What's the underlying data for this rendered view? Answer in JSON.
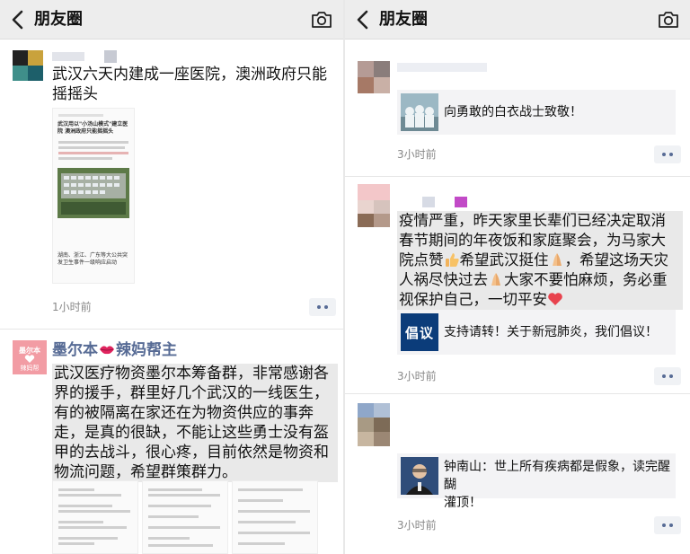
{
  "left": {
    "nav": {
      "title": "朋友圈",
      "back_icon": "chevron-left-icon",
      "camera_icon": "camera-icon"
    },
    "post1": {
      "text_lines": [
        "武汉六天内建成一座医院，澳洲政府只能",
        "摇摇头"
      ],
      "screenshot_title": "武汉用以\"小汤山模式\"建立医院 澳洲政府只能摇摇头",
      "screenshot_caption": "湖南、浙江、广东等大公共突发卫生事件一级响应启动",
      "time": "1小时前"
    },
    "post2": {
      "nickname": "墨尔本💋辣妈帮主",
      "nickname_main": "墨尔本",
      "nickname_tail": "辣妈帮主",
      "avatar_label_top": "墨尔本",
      "avatar_label_bottom": "辣妈帮",
      "text_lines": [
        "武汉医疗物资墨尔本筹备群，非常感谢各",
        "界的援手，群里好几个武汉的一线医生，",
        "有的被隔离在家还在为物资供应的事奔",
        "走，是真的很缺，不能让这些勇士没有盔",
        "甲的去战斗，很心疼，目前依然是物资和",
        "物流问题，希望群策群力。"
      ]
    }
  },
  "right": {
    "nav": {
      "title": "朋友圈",
      "back_icon": "chevron-left-icon",
      "camera_icon": "camera-icon"
    },
    "post1": {
      "share_text": "向勇敢的白衣战士致敬！",
      "time": "3小时前"
    },
    "post2": {
      "text_lines": [
        "疫情严重，昨天家里长辈们已经决定取消",
        "春节期间的年夜饭和家庭聚会，为马家大",
        "院点赞|👍|希望武汉挺住|🙏|，希望这场天灾",
        "人祸尽快过去|🙏|大家不要怕麻烦，务必重",
        "视保护自己，一切平安|❤️|"
      ],
      "line3": {
        "a": "院点赞",
        "b": "希望武汉挺住",
        "c": "，希望这场天灾"
      },
      "line4": {
        "a": "人祸尽快过去",
        "b": "大家不要怕麻烦，务必重"
      },
      "line5": {
        "a": "视保护自己，一切平安"
      },
      "share_thumb_text": "倡议",
      "share_text": "支持请转！关于新冠肺炎，我们倡议！",
      "time": "3小时前"
    },
    "post3": {
      "share_text_lines": [
        "钟南山：世上所有疾病都是假象，读完醒醐",
        "灌顶！"
      ],
      "time": "3小时前"
    }
  },
  "colors": {
    "nickname": "#576b95",
    "nav_bg": "#ededed",
    "card_bg": "#f3f3f5",
    "highlight": "#e9e9e9"
  }
}
